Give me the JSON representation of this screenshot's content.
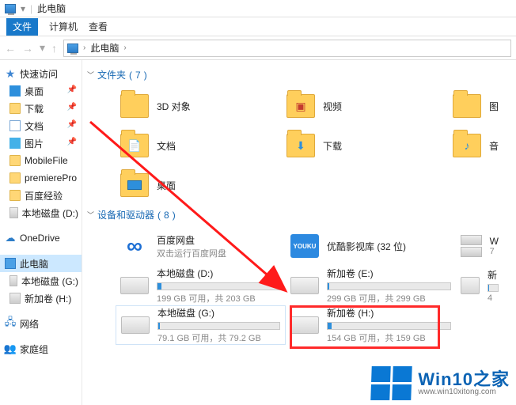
{
  "titlebar": {
    "title": "此电脑"
  },
  "ribbon": {
    "file_label": "文件",
    "tabs": [
      "计算机",
      "查看"
    ]
  },
  "breadcrumb": {
    "root": "此电脑"
  },
  "sidebar": {
    "items": [
      {
        "label": "快速访问",
        "icon": "star"
      },
      {
        "label": "桌面",
        "icon": "desk",
        "pin": true
      },
      {
        "label": "下载",
        "icon": "folder",
        "pin": true
      },
      {
        "label": "文档",
        "icon": "doc",
        "pin": true
      },
      {
        "label": "图片",
        "icon": "pic",
        "pin": true
      },
      {
        "label": "MobileFile",
        "icon": "folder"
      },
      {
        "label": "premierePro",
        "icon": "folder"
      },
      {
        "label": "百度经验",
        "icon": "folder"
      },
      {
        "label": "本地磁盘 (D:)",
        "icon": "drive"
      }
    ],
    "items2": [
      {
        "label": "OneDrive",
        "icon": "cloud"
      }
    ],
    "items3": [
      {
        "label": "此电脑",
        "icon": "pcsm",
        "selected": true
      },
      {
        "label": "本地磁盘 (G:)",
        "icon": "drive"
      },
      {
        "label": "新加卷 (H:)",
        "icon": "drive"
      }
    ],
    "items4": [
      {
        "label": "网络",
        "icon": "net"
      }
    ],
    "items5": [
      {
        "label": "家庭组",
        "icon": "home"
      }
    ]
  },
  "sections": {
    "folders": {
      "title": "文件夹",
      "count": 7,
      "items": [
        {
          "label": "3D 对象",
          "inner": ""
        },
        {
          "label": "视频",
          "inner": "▶"
        },
        {
          "label": "图",
          "inner": "",
          "edge": true
        },
        {
          "label": "文档",
          "inner": "📄"
        },
        {
          "label": "下载",
          "inner": "↓"
        },
        {
          "label": "音",
          "inner": "♪",
          "edge": true
        },
        {
          "label": "桌面",
          "inner": ""
        }
      ]
    },
    "drives": {
      "title": "设备和驱动器",
      "count": 8,
      "apps": [
        {
          "label": "百度网盘",
          "sub": "双击运行百度网盘",
          "kind": "baidu"
        },
        {
          "label": "优酷影视库 (32 位)",
          "sub": "",
          "kind": "youku"
        },
        {
          "label": "W",
          "sub": "7",
          "kind": "win",
          "edge": true
        }
      ],
      "list": [
        {
          "label": "本地磁盘 (D:)",
          "free": "199 GB 可用，共 203 GB",
          "pct": 3
        },
        {
          "label": "新加卷 (E:)",
          "free": "299 GB 可用，共 299 GB",
          "pct": 1
        },
        {
          "label": "新",
          "free": "4",
          "pct": 5,
          "edge": true
        },
        {
          "label": "本地磁盘 (G:)",
          "free": "79.1 GB 可用，共 79.2 GB",
          "pct": 1
        },
        {
          "label": "新加卷 (H:)",
          "free": "154 GB 可用，共 159 GB",
          "pct": 3,
          "highlighted": true
        }
      ]
    }
  },
  "watermark": {
    "brand": "Win10之家",
    "url": "www.win10xitong.com"
  }
}
